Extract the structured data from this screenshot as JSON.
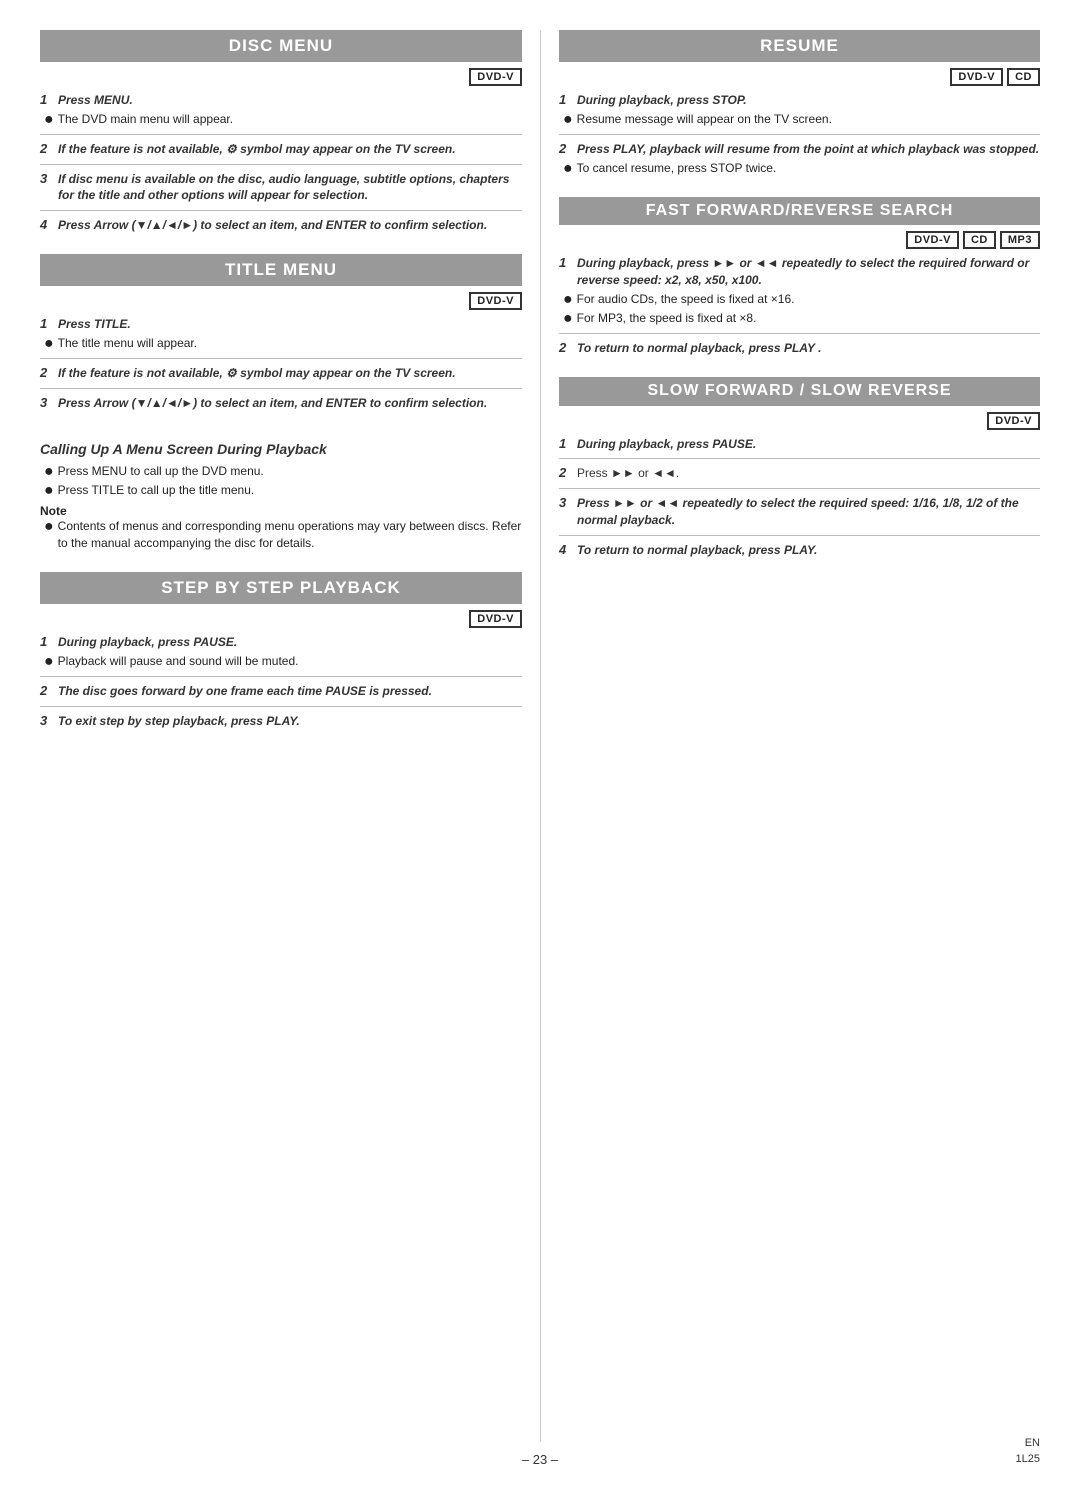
{
  "disc_menu": {
    "title": "Disc Menu",
    "badge": "DVD-V",
    "steps": [
      {
        "num": "1",
        "text": "Press MENU.",
        "bold": false,
        "bullets": [
          "The DVD main menu will appear."
        ]
      },
      {
        "num": "2",
        "text": "If the feature is not available,  symbol may appear on the TV screen.",
        "bold": true,
        "bullets": []
      },
      {
        "num": "3",
        "text": "If disc menu is available on the disc, audio language, subtitle options, chapters for the title and other options will appear for selection.",
        "bold": true,
        "bullets": []
      },
      {
        "num": "4",
        "text": "Press Arrow (▼/▲/◄/►) to select an item, and ENTER to confirm selection.",
        "bold": true,
        "bullets": []
      }
    ]
  },
  "title_menu": {
    "title": "Title Menu",
    "badge": "DVD-V",
    "steps": [
      {
        "num": "1",
        "text": "Press TITLE.",
        "bold": false,
        "bullets": [
          "The title menu will appear."
        ]
      },
      {
        "num": "2",
        "text": "If the feature is not available,  symbol may appear on the TV screen.",
        "bold": true,
        "bullets": []
      },
      {
        "num": "3",
        "text": "Press Arrow (▼/▲/◄/►) to select an item, and ENTER to confirm selection.",
        "bold": true,
        "bullets": []
      }
    ]
  },
  "calling_menu": {
    "title": "Calling Up A Menu Screen During Playback",
    "bullets": [
      "Press MENU to call up the DVD menu.",
      "Press TITLE to call up the title menu."
    ],
    "note_label": "Note",
    "note_text": "Contents of menus and corresponding menu operations may vary between discs. Refer to the manual accompanying the disc for details."
  },
  "step_by_step": {
    "title": "Step By Step Playback",
    "badge": "DVD-V",
    "steps": [
      {
        "num": "1",
        "text": "During playback, press PAUSE.",
        "bold": true,
        "bullets": [
          "Playback will pause and sound will be muted."
        ]
      },
      {
        "num": "2",
        "text": "The disc goes forward by one frame each time PAUSE is pressed.",
        "bold": true,
        "bullets": []
      },
      {
        "num": "3",
        "text": "To exit step by step playback, press PLAY.",
        "bold": true,
        "bullets": []
      }
    ]
  },
  "resume": {
    "title": "Resume",
    "badge1": "DVD-V",
    "badge2": "CD",
    "steps": [
      {
        "num": "1",
        "text": "During playback, press STOP.",
        "bold": true,
        "bullets": [
          "Resume message will appear on the TV screen."
        ]
      },
      {
        "num": "2",
        "text": "Press PLAY, playback will resume from the point at which playback was stopped.",
        "bold": true,
        "bullets": [
          "To cancel resume, press STOP twice."
        ]
      }
    ]
  },
  "fast_forward": {
    "title": "Fast Forward/Reverse Search",
    "badge1": "DVD-V",
    "badge2": "CD",
    "badge3": "MP3",
    "steps": [
      {
        "num": "1",
        "text": "During playback, press ►► or ◄◄ repeatedly to select the required forward or reverse speed: x2, x8, x50, x100.",
        "bold": true,
        "bullets": [
          "For audio CDs, the speed is fixed at ×16.",
          "For MP3, the speed is fixed at ×8."
        ]
      },
      {
        "num": "2",
        "text": "To return to normal playback, press PLAY .",
        "bold": true,
        "bullets": []
      }
    ]
  },
  "slow_forward": {
    "title": "Slow Forward / Slow Reverse",
    "badge": "DVD-V",
    "steps": [
      {
        "num": "1",
        "text": "During playback, press PAUSE.",
        "bold": false,
        "bullets": []
      },
      {
        "num": "2",
        "text": "Press ►► or ◄◄.",
        "bold": false,
        "bullets": []
      },
      {
        "num": "3",
        "text": "Press ►► or ◄◄ repeatedly to select the required speed: 1/16, 1/8, 1/2 of the normal playback.",
        "bold": true,
        "bullets": []
      },
      {
        "num": "4",
        "text": "To return to normal playback, press PLAY.",
        "bold": true,
        "bullets": []
      }
    ]
  },
  "footer": {
    "page_number": "– 23 –",
    "lang": "EN",
    "code": "1L25"
  }
}
